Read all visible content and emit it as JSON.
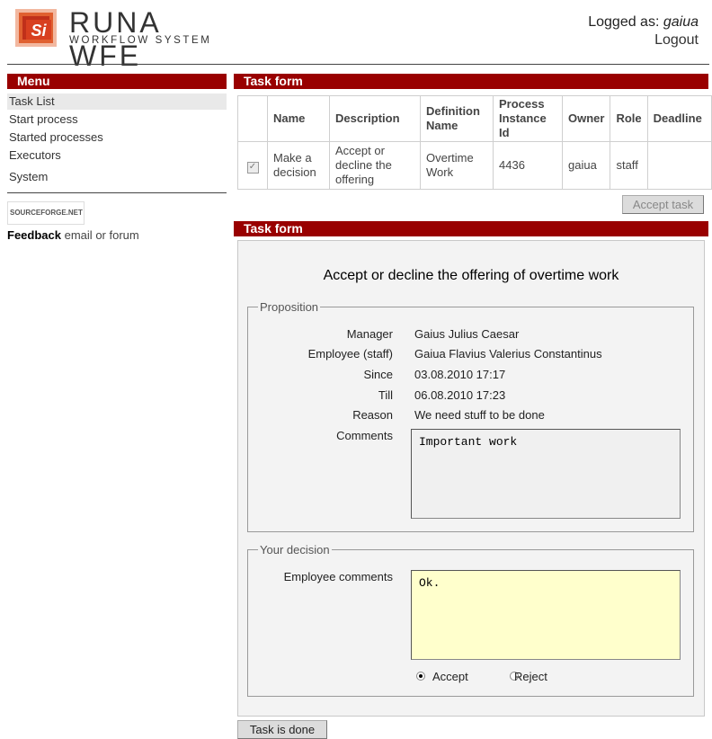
{
  "header": {
    "brand_mark": "SI",
    "brand_title": "RUNA WFE",
    "brand_subtitle": "WORKFLOW SYSTEM",
    "logged_prefix": "Logged as: ",
    "logged_user": "gaiua",
    "logout": "Logout"
  },
  "menu": {
    "title": "Menu",
    "items": [
      {
        "label": "Task List",
        "selected": true
      },
      {
        "label": "Start process"
      },
      {
        "label": "Started processes"
      },
      {
        "label": "Executors"
      },
      {
        "label": "System"
      }
    ],
    "sourceforge": "SOURCEFORGE.NET",
    "feedback_label": "Feedback",
    "feedback_email": "email",
    "feedback_or": "or",
    "feedback_forum": "forum"
  },
  "tasks": {
    "title": "Task form",
    "columns": [
      "",
      "Name",
      "Description",
      "Definition Name",
      "Process Instance Id",
      "Owner",
      "Role",
      "Deadline"
    ],
    "rows": [
      {
        "checked": true,
        "name": "Make a decision",
        "description": "Accept or decline the offering",
        "definition": "Overtime Work",
        "pid": "4436",
        "owner": "gaiua",
        "role": "staff",
        "deadline": ""
      }
    ],
    "accept_button": "Accept task"
  },
  "form": {
    "bar_title": "Task form",
    "title": "Accept or decline the offering of overtime work",
    "proposition_legend": "Proposition",
    "fields": {
      "manager_label": "Manager",
      "manager": "Gaius Julius Caesar",
      "employee_label": "Employee (staff)",
      "employee": "Gaiua Flavius Valerius Constantinus",
      "since_label": "Since",
      "since": "03.08.2010 17:17",
      "till_label": "Till",
      "till": "06.08.2010 17:23",
      "reason_label": "Reason",
      "reason": "We need stuff to be done",
      "comments_label": "Comments",
      "comments": "Important work"
    },
    "decision_legend": "Your decision",
    "employee_comments_label": "Employee comments",
    "employee_comments": "Ok.",
    "accept_label": "Accept",
    "reject_label": "Reject",
    "selected": "Accept",
    "done_button": "Task is done"
  },
  "colors": {
    "bar": "#990000",
    "highlight_input": "#ffffcc"
  }
}
